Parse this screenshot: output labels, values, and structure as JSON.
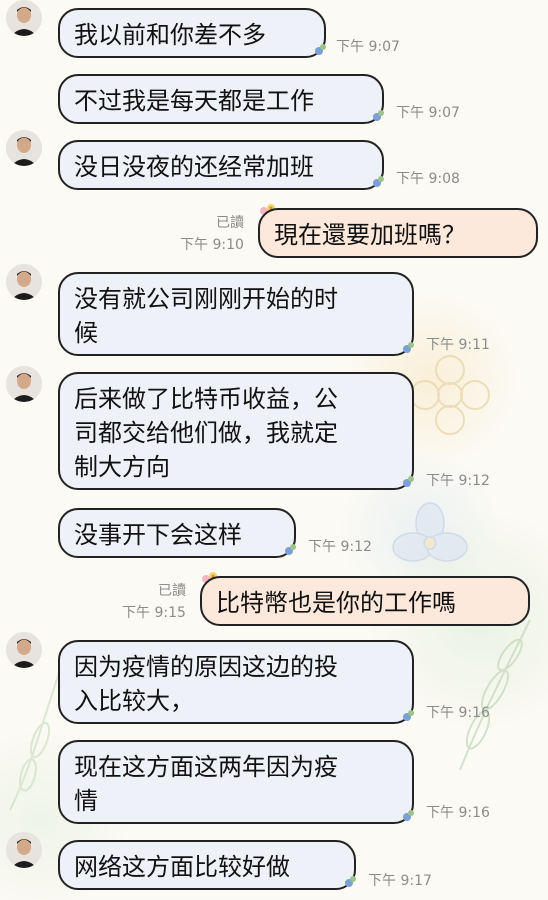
{
  "colors": {
    "incoming_bubble": "#eef1f8",
    "outgoing_bubble": "#fde8dc",
    "timestamp": "#8b8b8b",
    "bubble_border": "#222222"
  },
  "messages": [
    {
      "direction": "in",
      "avatar": true,
      "lines": [
        "我以前和你差不多"
      ],
      "time": "下午 9:07"
    },
    {
      "direction": "in",
      "avatar": false,
      "lines": [
        "不过我是每天都是工作"
      ],
      "time": "下午 9:07"
    },
    {
      "direction": "in",
      "avatar": true,
      "lines": [
        "没日没夜的还经常加班"
      ],
      "time": "下午 9:08"
    },
    {
      "direction": "out",
      "read": "已讀",
      "lines": [
        "現在還要加班嗎？"
      ],
      "time": "下午 9:10"
    },
    {
      "direction": "in",
      "avatar": true,
      "lines": [
        "没有就公司刚刚开始的时",
        "候"
      ],
      "time": "下午 9:11"
    },
    {
      "direction": "in",
      "avatar": true,
      "lines": [
        "后来做了比特币收益，公",
        "司都交给他们做，我就定",
        "制大方向"
      ],
      "time": "下午 9:12"
    },
    {
      "direction": "in",
      "avatar": false,
      "lines": [
        "没事开下会这样"
      ],
      "time": "下午 9:12"
    },
    {
      "direction": "out",
      "read": "已讀",
      "lines": [
        "比特幣也是你的工作嗎"
      ],
      "time": "下午 9:15"
    },
    {
      "direction": "in",
      "avatar": true,
      "lines": [
        "因为疫情的原因这边的投",
        "入比较大，"
      ],
      "time": "下午 9:16"
    },
    {
      "direction": "in",
      "avatar": false,
      "lines": [
        "现在这方面这两年因为疫",
        "情"
      ],
      "time": "下午 9:16"
    },
    {
      "direction": "in",
      "avatar": true,
      "lines": [
        "网络这方面比较好做"
      ],
      "time": "下午 9:17"
    }
  ]
}
